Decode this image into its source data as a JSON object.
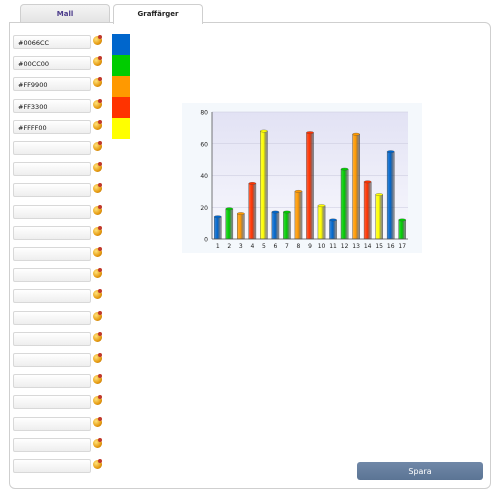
{
  "tabs": [
    {
      "label": "Mall"
    },
    {
      "label": "Graffärger"
    }
  ],
  "colors": [
    "#0066CC",
    "#00CC00",
    "#FF9900",
    "#FF3300",
    "#FFFF00",
    "",
    "",
    "",
    "",
    "",
    "",
    "",
    "",
    "",
    "",
    "",
    "",
    "",
    "",
    "",
    ""
  ],
  "swatch_colors": [
    "#0066CC",
    "#00CC00",
    "#FF9900",
    "#FF3300",
    "#FFFF00"
  ],
  "save_label": "Spara",
  "chart_data": {
    "type": "bar",
    "categories": [
      "1",
      "2",
      "3",
      "4",
      "5",
      "6",
      "7",
      "8",
      "9",
      "10",
      "11",
      "12",
      "13",
      "14",
      "15",
      "16",
      "17"
    ],
    "values": [
      14,
      19,
      16,
      35,
      68,
      17,
      17,
      30,
      67,
      21,
      12,
      44,
      66,
      36,
      28,
      55,
      12
    ],
    "bar_colors": [
      "#0066CC",
      "#00CC00",
      "#FF9900",
      "#FF3300",
      "#FFFF00",
      "#0066CC",
      "#00CC00",
      "#FF9900",
      "#FF3300",
      "#FFFF00",
      "#0066CC",
      "#00CC00",
      "#FF9900",
      "#FF3300",
      "#FFFF00",
      "#0066CC",
      "#00CC00"
    ],
    "ylim": [
      0,
      80
    ],
    "yticks": [
      0,
      20,
      40,
      60,
      80
    ],
    "grid": true,
    "title": "",
    "xlabel": "",
    "ylabel": ""
  }
}
